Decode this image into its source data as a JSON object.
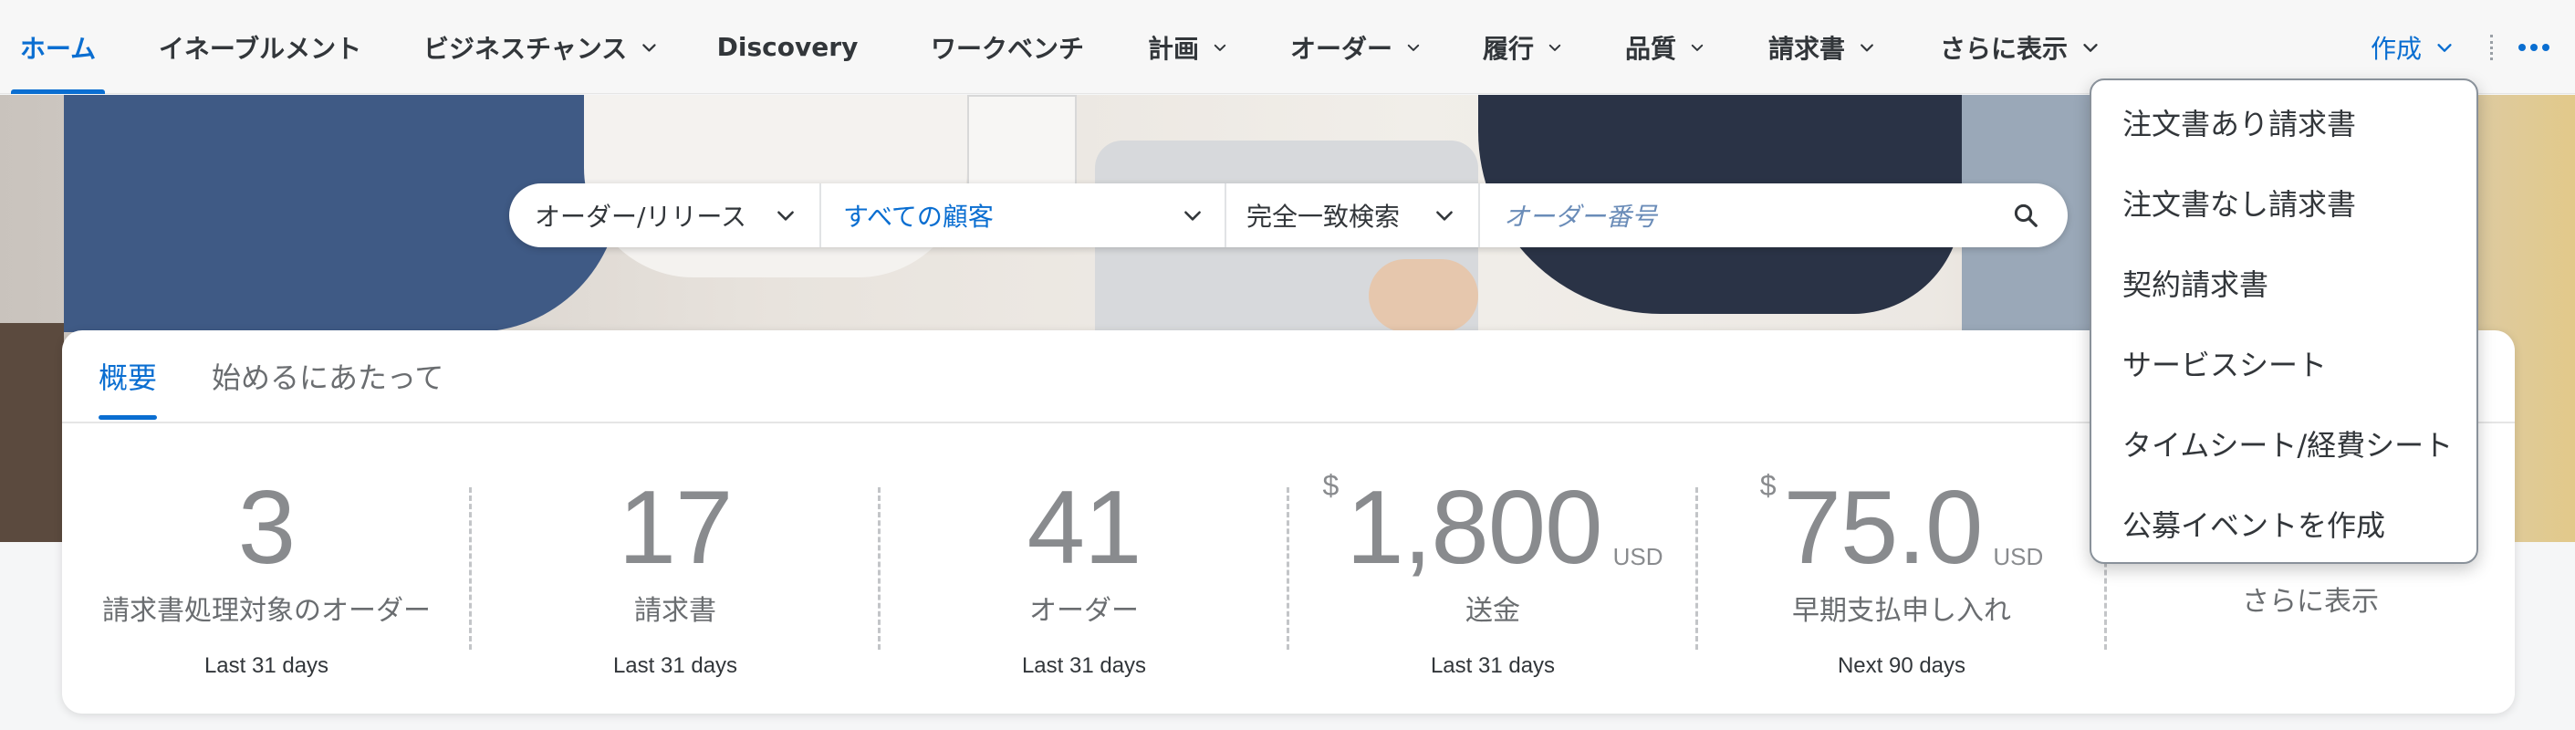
{
  "nav": {
    "items": [
      {
        "label": "ホーム",
        "active": true,
        "has_dropdown": false
      },
      {
        "label": "イネーブルメント",
        "active": false,
        "has_dropdown": false
      },
      {
        "label": "ビジネスチャンス",
        "active": false,
        "has_dropdown": true
      },
      {
        "label": "Discovery",
        "active": false,
        "has_dropdown": true
      },
      {
        "label": "ワークベンチ",
        "active": false,
        "has_dropdown": false
      },
      {
        "label": "計画",
        "active": false,
        "has_dropdown": true
      },
      {
        "label": "オーダー",
        "active": false,
        "has_dropdown": true
      },
      {
        "label": "履行",
        "active": false,
        "has_dropdown": true
      },
      {
        "label": "品質",
        "active": false,
        "has_dropdown": true
      },
      {
        "label": "請求書",
        "active": false,
        "has_dropdown": true
      },
      {
        "label": "さらに表示",
        "active": false,
        "has_dropdown": true
      }
    ],
    "create_label": "作成",
    "overflow_icon": "more-horizontal-icon"
  },
  "search": {
    "type_value": "オーダー/リリース",
    "customer_value": "すべての顧客",
    "match_value": "完全一致検索",
    "query_placeholder": "オーダー番号"
  },
  "card": {
    "tabs": [
      {
        "label": "概要",
        "active": true
      },
      {
        "label": "始めるにあたって",
        "active": false
      }
    ],
    "tiles": [
      {
        "value": "3",
        "currency": "",
        "unit": "",
        "label": "請求書処理対象のオーダー",
        "period": "Last 31 days"
      },
      {
        "value": "17",
        "currency": "",
        "unit": "",
        "label": "請求書",
        "period": "Last 31 days"
      },
      {
        "value": "41",
        "currency": "",
        "unit": "",
        "label": "オーダー",
        "period": "Last 31 days"
      },
      {
        "value": "1,800",
        "currency": "$",
        "unit": "USD",
        "label": "送金",
        "period": "Last 31 days"
      },
      {
        "value": "75.0",
        "currency": "$",
        "unit": "USD",
        "label": "早期支払申し入れ",
        "period": "Next 90 days"
      }
    ],
    "more_label": "さらに表示"
  },
  "create_menu": {
    "items": [
      "注文書あり請求書",
      "注文書なし請求書",
      "契約請求書",
      "サービスシート",
      "タイムシート/経費シート",
      "公募イベントを作成"
    ]
  },
  "colors": {
    "accent": "#0a6ed1",
    "text": "#32363a",
    "kpi_number": "#898b8e",
    "nav_background": "#f7f7f7"
  }
}
